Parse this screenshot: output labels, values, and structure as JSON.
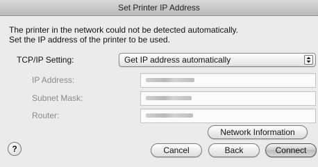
{
  "window": {
    "title": "Set Printer IP Address"
  },
  "message": {
    "line1": "The printer in the network could not be detected automatically.",
    "line2": "Set the IP address of the printer to be used."
  },
  "tcpip": {
    "label": "TCP/IP Setting:",
    "selected": "Get IP address automatically",
    "arrow_icon": "up-down-arrows-icon"
  },
  "fields": {
    "ip_label": "IP Address:",
    "subnet_label": "Subnet Mask:",
    "router_label": "Router:"
  },
  "buttons": {
    "network_info": "Network Information",
    "cancel": "Cancel",
    "back": "Back",
    "connect": "Connect",
    "help": "?"
  }
}
